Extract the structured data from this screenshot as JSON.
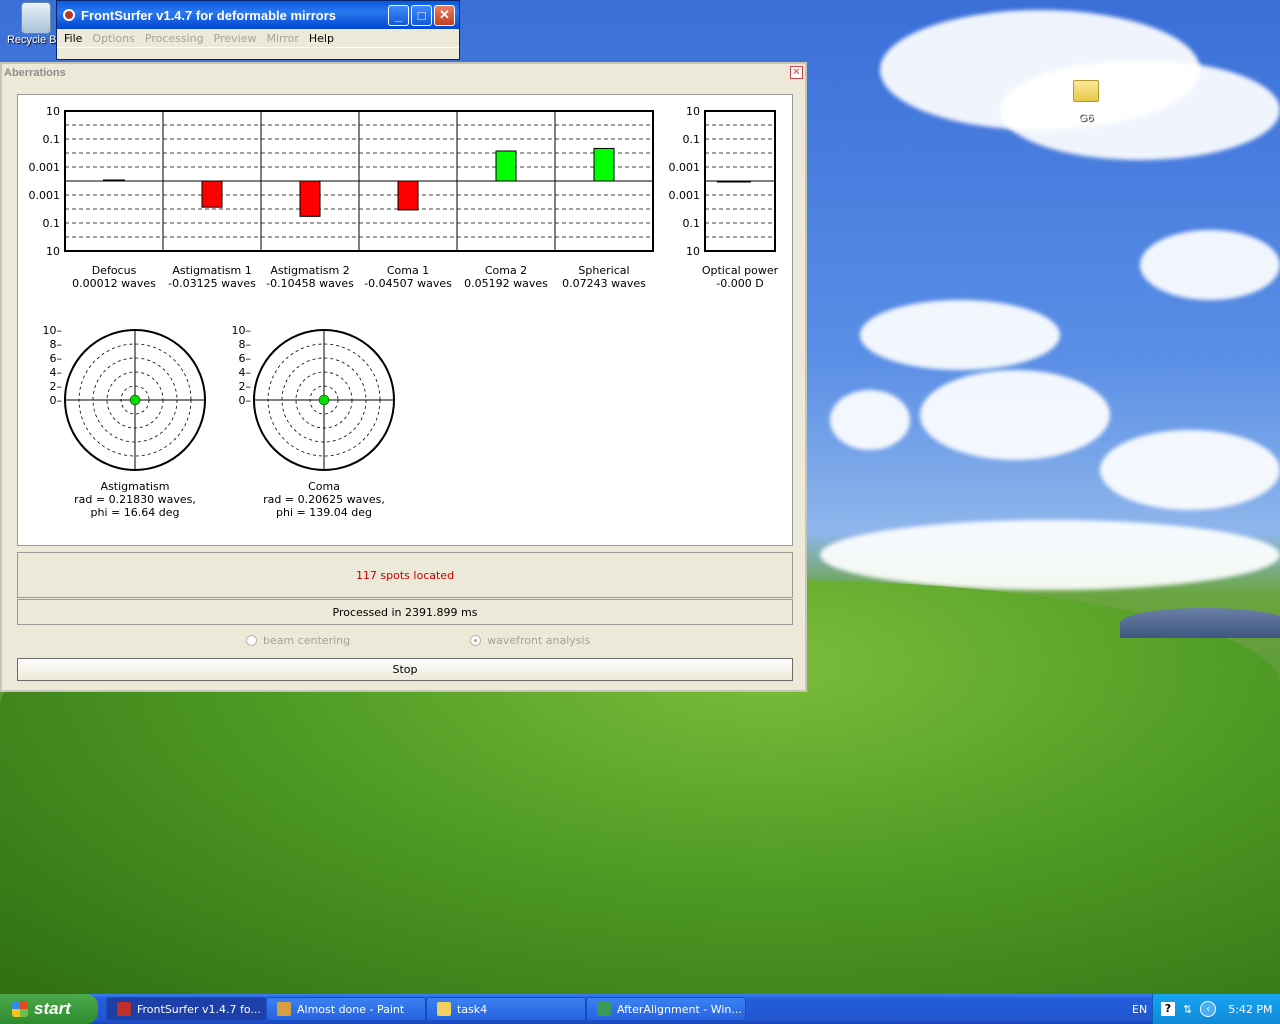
{
  "desktop": {
    "recycle_label": "Recycle Bin",
    "folder_label": "G6"
  },
  "main_window": {
    "title": "FrontSurfer v1.4.7 for deformable mirrors",
    "menu": [
      {
        "label": "File",
        "enabled": true
      },
      {
        "label": "Options",
        "enabled": false
      },
      {
        "label": "Processing",
        "enabled": false
      },
      {
        "label": "Preview",
        "enabled": false
      },
      {
        "label": "Mirror",
        "enabled": false
      },
      {
        "label": "Help",
        "enabled": true
      }
    ]
  },
  "aberrations": {
    "title": "Aberrations",
    "y_tick_labels": [
      "10",
      "0.1",
      "0.001",
      "0.001",
      "0.1",
      "10"
    ],
    "bars": [
      {
        "name": "Defocus",
        "value_text": "0.00012 waves",
        "value": 0.00012,
        "color": "#000000"
      },
      {
        "name": "Astigmatism 1",
        "value_text": "-0.03125 waves",
        "value": -0.03125,
        "color": "#ff0000"
      },
      {
        "name": "Astigmatism 2",
        "value_text": "-0.10458 waves",
        "value": -0.10458,
        "color": "#ff0000"
      },
      {
        "name": "Coma 1",
        "value_text": "-0.04507 waves",
        "value": -0.04507,
        "color": "#ff0000"
      },
      {
        "name": "Coma 2",
        "value_text": "0.05192 waves",
        "value": 0.05192,
        "color": "#00ff00"
      },
      {
        "name": "Spherical",
        "value_text": "0.07243 waves",
        "value": 0.07243,
        "color": "#00ff00"
      }
    ],
    "optical_power": {
      "name": "Optical power",
      "value_text": "-0.000 D",
      "value": 0.0
    },
    "polar_tick_labels": [
      "10",
      "8",
      "6",
      "4",
      "2",
      "0"
    ],
    "polar": [
      {
        "name": "Astigmatism",
        "rad_text": "rad = 0.21830 waves,",
        "phi_text": "phi = 16.64 deg"
      },
      {
        "name": "Coma",
        "rad_text": "rad = 0.20625 waves,",
        "phi_text": "phi = 139.04 deg"
      }
    ],
    "spots_text": "117 spots located",
    "processed_text": "Processed in 2391.899 ms",
    "radio_beam": "beam centering",
    "radio_wavefront": "wavefront analysis",
    "stop_label": "Stop"
  },
  "taskbar": {
    "start_label": "start",
    "tasks": [
      {
        "label": "FrontSurfer v1.4.7 fo..."
      },
      {
        "label": "Almost done - Paint"
      },
      {
        "label": "task4"
      },
      {
        "label": "AfterAlignment - Win..."
      }
    ],
    "lang": "EN",
    "clock": "5:42 PM"
  },
  "colors": {
    "negative_bar": "#ff0000",
    "positive_bar": "#00ff00",
    "spots_text": "#cc0000"
  }
}
